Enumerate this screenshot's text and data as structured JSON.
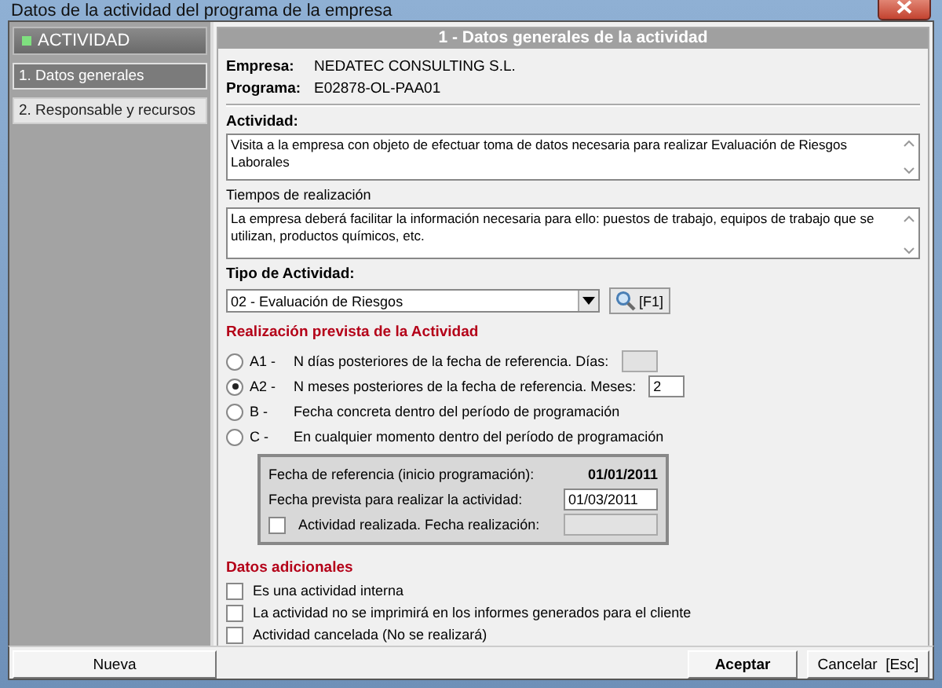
{
  "window": {
    "title": "Datos de la actividad del programa de la empresa"
  },
  "sidebar": {
    "header": "ACTIVIDAD",
    "items": [
      {
        "label": "1. Datos generales",
        "selected": true
      },
      {
        "label": "2. Responsable y recursos",
        "selected": false
      }
    ]
  },
  "panel": {
    "title": "1 - Datos generales de la actividad",
    "info": [
      {
        "label": "Empresa:",
        "value": "NEDATEC CONSULTING S.L."
      },
      {
        "label": "Programa:",
        "value": "E02878-OL-PAA01"
      }
    ],
    "actividad": {
      "label": "Actividad:",
      "value": "Visita a la empresa con objeto de efectuar toma de datos necesaria para realizar Evaluación de Riesgos Laborales"
    },
    "tiempos": {
      "label": "Tiempos de realización",
      "value": "La empresa deberá facilitar la información necesaria para ello: puestos de trabajo, equipos de trabajo que se utilizan, productos químicos, etc."
    },
    "tipo": {
      "label": "Tipo de Actividad:",
      "value": "02 - Evaluación de Riesgos",
      "button": "[F1]"
    },
    "realizacion": {
      "title": "Realización prevista de la Actividad",
      "options": [
        {
          "key": "A1 -",
          "text": "N días posteriores de la fecha de referencia. Días:",
          "selected": false,
          "field": {
            "disabled": true
          }
        },
        {
          "key": "A2 -",
          "text": "N meses posteriores de la fecha de referencia. Meses:",
          "selected": true,
          "field": {
            "value": "2",
            "disabled": false
          }
        },
        {
          "key": "B -",
          "text": "Fecha concreta dentro del período de programación",
          "selected": false
        },
        {
          "key": "C -",
          "text": "En cualquier momento dentro del período de programación",
          "selected": false
        }
      ]
    },
    "fechas": {
      "referencia": {
        "label": "Fecha de referencia (inicio programación):",
        "value": "01/01/2011"
      },
      "prevista": {
        "label": "Fecha prevista para realizar la actividad:",
        "value": "01/03/2011"
      },
      "realizada": {
        "label": "Actividad realizada. Fecha realización:",
        "checked": false,
        "disabled": true
      }
    },
    "adicionales": {
      "title": "Datos adicionales",
      "items": [
        {
          "label": "Es una actividad interna",
          "checked": false
        },
        {
          "label": "La actividad no se imprimirá en los informes generados para el cliente",
          "checked": false
        },
        {
          "label": "Actividad cancelada (No se realizará)",
          "checked": false
        }
      ]
    }
  },
  "buttons": {
    "nueva": "Nueva",
    "aceptar": "Aceptar",
    "cancelar": "Cancelar  [Esc]"
  }
}
